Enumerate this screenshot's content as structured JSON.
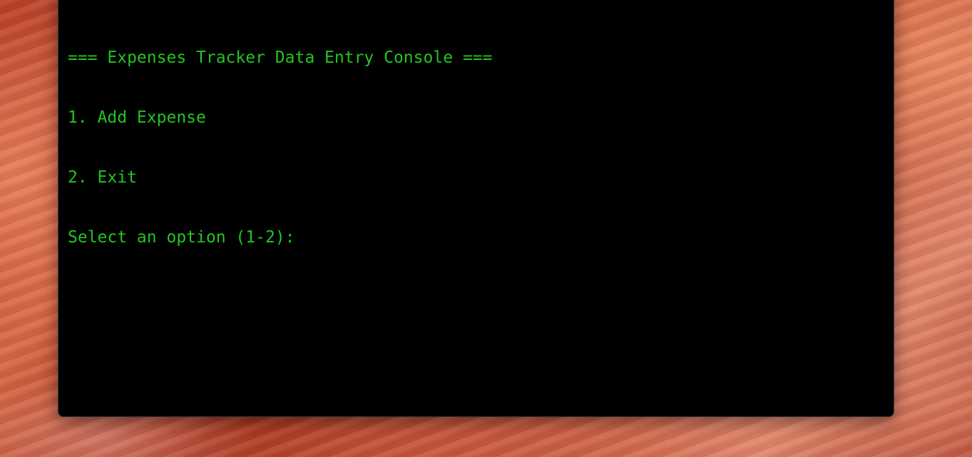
{
  "terminal": {
    "text_color": "#22c522",
    "background_color": "#000000",
    "lines": [
      "=== Expenses Tracker Data Entry Console ===",
      "1. Add Expense",
      "2. Exit",
      "Select an option (1-2): "
    ]
  }
}
